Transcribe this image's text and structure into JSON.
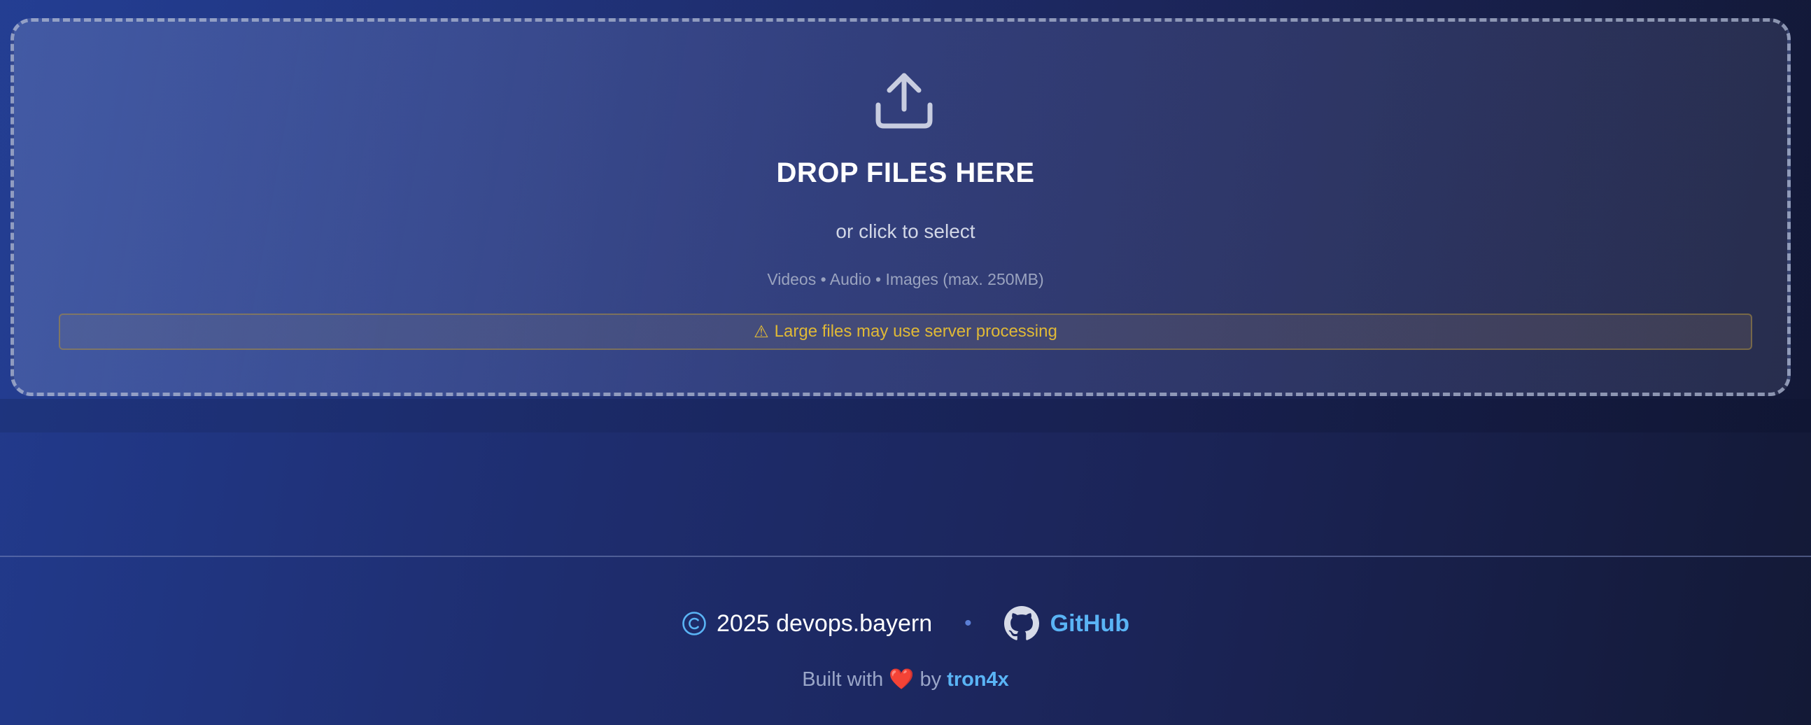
{
  "upload": {
    "icon": "upload-icon",
    "title": "DROP FILES HERE",
    "subtitle": "or click to select",
    "types": "Videos • Audio • Images (max. 250MB)",
    "warning_icon": "⚠",
    "warning_text": "Large files may use server processing"
  },
  "footer": {
    "copyright_icon": "copyright-icon",
    "copyright_text": "2025 devops.bayern",
    "separator": "•",
    "github_icon": "github-icon",
    "github_label": "GitHub",
    "built_prefix": "Built with",
    "heart": "❤️",
    "built_by": "by",
    "author": "tron4x"
  },
  "colors": {
    "accent": "#5ab4f5",
    "warning": "#e0b936",
    "background_start": "#223b8e",
    "background_end": "#131936"
  }
}
